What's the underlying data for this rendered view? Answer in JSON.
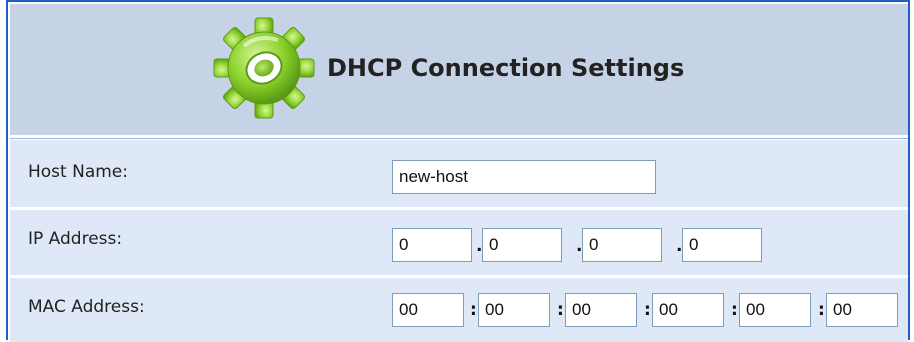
{
  "header": {
    "title": "DHCP Connection Settings",
    "icon": "gear-icon",
    "background_color": "#c6d3e7"
  },
  "form": {
    "host_name": {
      "label": "Host Name:",
      "value": "new-host"
    },
    "ip_address": {
      "label": "IP Address:",
      "octets": [
        "0",
        "0",
        "0",
        "0"
      ],
      "separator": "."
    },
    "mac_address": {
      "label": "MAC Address:",
      "bytes": [
        "00",
        "00",
        "00",
        "00",
        "00",
        "00"
      ],
      "separator": ":"
    }
  },
  "colors": {
    "frame_border": "#1f5fc2",
    "row_background": "#dfe8f7",
    "input_border": "#7f9db9",
    "gear_green": "#8bd12a"
  }
}
